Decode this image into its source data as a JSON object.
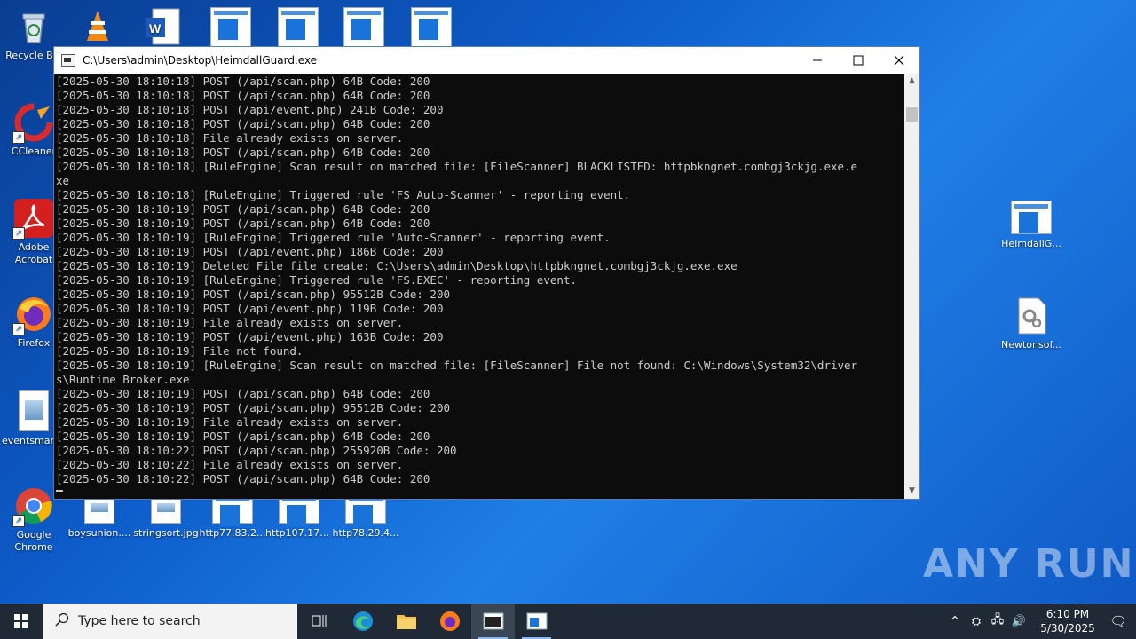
{
  "desktop": {
    "icons_left": [
      {
        "label": "Recycle Bin",
        "icon": "recycle-bin-icon"
      },
      {
        "label": "CCleaner",
        "icon": "ccleaner-icon"
      },
      {
        "label": "Adobe Acrobat",
        "icon": "adobe-acrobat-icon"
      },
      {
        "label": "Firefox",
        "icon": "firefox-icon"
      },
      {
        "label": "eventsman...",
        "icon": "image-file-icon"
      },
      {
        "label": "Google Chrome",
        "icon": "chrome-icon"
      }
    ],
    "icons_bottom": [
      {
        "label": "boysunion...."
      },
      {
        "label": "stringsort.jpg"
      },
      {
        "label": "http77.83.2..."
      },
      {
        "label": "http107.175..."
      },
      {
        "label": "http78.29.4..."
      }
    ],
    "icons_right": [
      {
        "label": "HeimdallG..."
      },
      {
        "label": "Newtonsof..."
      }
    ],
    "watermark": "ANY RUN"
  },
  "console": {
    "title": "C:\\Users\\admin\\Desktop\\HeimdallGuard.exe",
    "lines": [
      "[2025-05-30 18:10:18] POST (/api/scan.php) 64B Code: 200",
      "[2025-05-30 18:10:18] POST (/api/scan.php) 64B Code: 200",
      "[2025-05-30 18:10:18] POST (/api/event.php) 241B Code: 200",
      "[2025-05-30 18:10:18] POST (/api/scan.php) 64B Code: 200",
      "[2025-05-30 18:10:18] File already exists on server.",
      "[2025-05-30 18:10:18] POST (/api/scan.php) 64B Code: 200",
      "[2025-05-30 18:10:18] [RuleEngine] Scan result on matched file: [FileScanner] BLACKLISTED: httpbkngnet.combgj3ckjg.exe.e",
      "xe",
      "[2025-05-30 18:10:18] [RuleEngine] Triggered rule 'FS Auto-Scanner' - reporting event.",
      "[2025-05-30 18:10:19] POST (/api/scan.php) 64B Code: 200",
      "[2025-05-30 18:10:19] POST (/api/scan.php) 64B Code: 200",
      "[2025-05-30 18:10:19] [RuleEngine] Triggered rule 'Auto-Scanner' - reporting event.",
      "[2025-05-30 18:10:19] POST (/api/event.php) 186B Code: 200",
      "[2025-05-30 18:10:19] Deleted File file_create: C:\\Users\\admin\\Desktop\\httpbkngnet.combgj3ckjg.exe.exe",
      "[2025-05-30 18:10:19] [RuleEngine] Triggered rule 'FS.EXEC' - reporting event.",
      "[2025-05-30 18:10:19] POST (/api/scan.php) 95512B Code: 200",
      "[2025-05-30 18:10:19] POST (/api/event.php) 119B Code: 200",
      "[2025-05-30 18:10:19] File already exists on server.",
      "[2025-05-30 18:10:19] POST (/api/event.php) 163B Code: 200",
      "[2025-05-30 18:10:19] File not found.",
      "[2025-05-30 18:10:19] [RuleEngine] Scan result on matched file: [FileScanner] File not found: C:\\Windows\\System32\\driver",
      "s\\Runtime Broker.exe",
      "[2025-05-30 18:10:19] POST (/api/scan.php) 64B Code: 200",
      "[2025-05-30 18:10:19] POST (/api/scan.php) 95512B Code: 200",
      "[2025-05-30 18:10:19] File already exists on server.",
      "[2025-05-30 18:10:19] POST (/api/scan.php) 64B Code: 200",
      "[2025-05-30 18:10:22] POST (/api/scan.php) 255920B Code: 200",
      "[2025-05-30 18:10:22] File already exists on server.",
      "[2025-05-30 18:10:22] POST (/api/scan.php) 64B Code: 200"
    ]
  },
  "taskbar": {
    "search_placeholder": "Type here to search",
    "time": "6:10 PM",
    "date": "5/30/2025"
  }
}
